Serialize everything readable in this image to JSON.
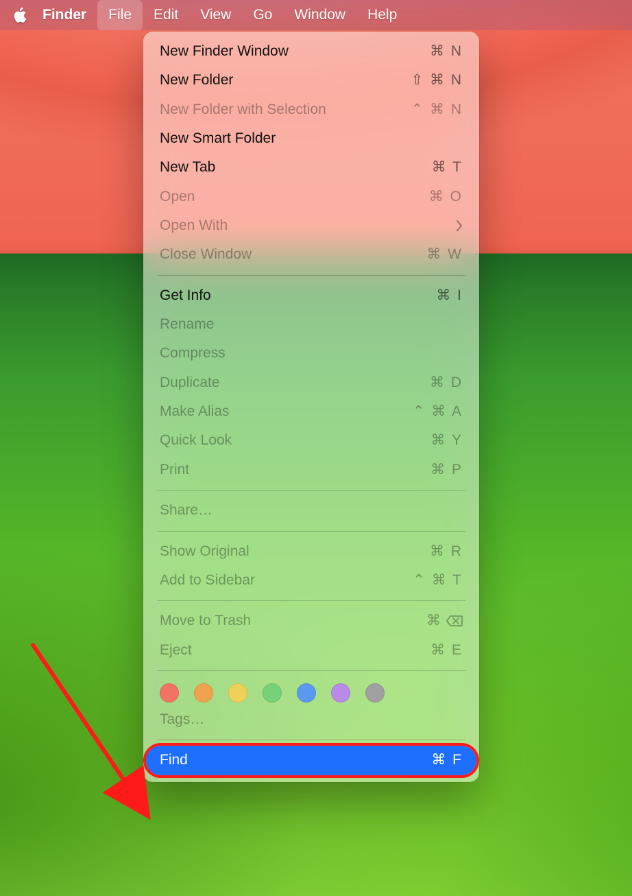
{
  "menubar": {
    "app": "Finder",
    "active": "File",
    "items": [
      "File",
      "Edit",
      "View",
      "Go",
      "Window",
      "Help"
    ]
  },
  "dropdown": {
    "groups": [
      [
        {
          "label": "New Finder Window",
          "shortcut": "⌘ N",
          "disabled": false
        },
        {
          "label": "New Folder",
          "shortcut": "⇧ ⌘ N",
          "disabled": false
        },
        {
          "label": "New Folder with Selection",
          "shortcut": "⌃ ⌘ N",
          "disabled": true
        },
        {
          "label": "New Smart Folder",
          "shortcut": "",
          "disabled": false
        },
        {
          "label": "New Tab",
          "shortcut": "⌘ T",
          "disabled": false
        },
        {
          "label": "Open",
          "shortcut": "⌘ O",
          "disabled": true
        },
        {
          "label": "Open With",
          "shortcut": "",
          "disabled": true,
          "submenu": true
        },
        {
          "label": "Close Window",
          "shortcut": "⌘ W",
          "disabled": true
        }
      ],
      [
        {
          "label": "Get Info",
          "shortcut": "⌘ I",
          "disabled": false
        },
        {
          "label": "Rename",
          "shortcut": "",
          "disabled": true
        },
        {
          "label": "Compress",
          "shortcut": "",
          "disabled": true
        },
        {
          "label": "Duplicate",
          "shortcut": "⌘ D",
          "disabled": true
        },
        {
          "label": "Make Alias",
          "shortcut": "⌃ ⌘ A",
          "disabled": true
        },
        {
          "label": "Quick Look",
          "shortcut": "⌘ Y",
          "disabled": true
        },
        {
          "label": "Print",
          "shortcut": "⌘ P",
          "disabled": true
        }
      ],
      [
        {
          "label": "Share…",
          "shortcut": "",
          "disabled": true
        }
      ],
      [
        {
          "label": "Show Original",
          "shortcut": "⌘ R",
          "disabled": true
        },
        {
          "label": "Add to Sidebar",
          "shortcut": "⌃ ⌘ T",
          "disabled": true
        }
      ],
      [
        {
          "label": "Move to Trash",
          "shortcut": "⌘",
          "disabled": true,
          "backspace": true
        },
        {
          "label": "Eject",
          "shortcut": "⌘ E",
          "disabled": true
        }
      ]
    ],
    "tag_colors": [
      "#f07363",
      "#f0a24e",
      "#f0d157",
      "#77d178",
      "#5a99f0",
      "#b98ae6",
      "#a0a0a0"
    ],
    "tags_label": "Tags…",
    "find": {
      "label": "Find",
      "shortcut": "⌘ F"
    }
  }
}
